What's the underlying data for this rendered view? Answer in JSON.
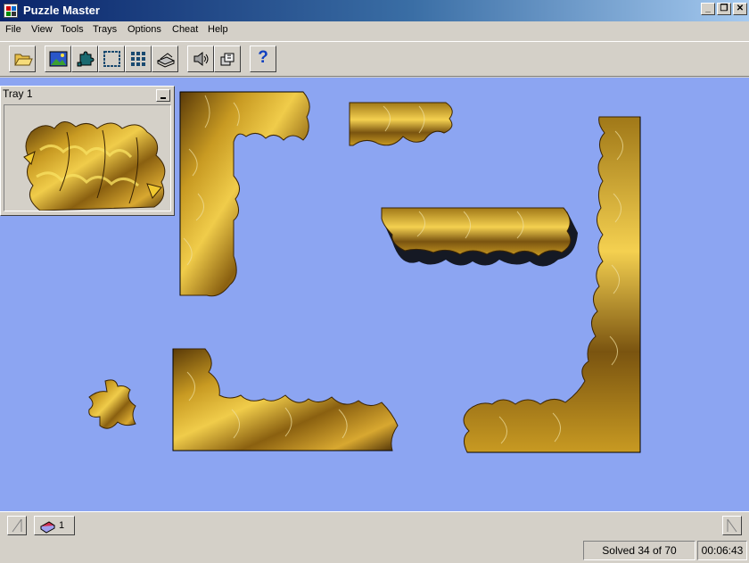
{
  "window": {
    "title": "Puzzle Master"
  },
  "menu": [
    "File",
    "View",
    "Tools",
    "Trays",
    "Options",
    "Cheat",
    "Help"
  ],
  "toolbar": {
    "buttons": [
      {
        "icon": "open-folder-icon"
      },
      {
        "icon": "picture-icon"
      },
      {
        "icon": "puzzle-pieces-icon"
      },
      {
        "icon": "border-frame-icon"
      },
      {
        "icon": "grid-icon"
      },
      {
        "icon": "tray-icon"
      },
      {
        "icon": "speaker-icon"
      },
      {
        "icon": "pieces-stack-icon"
      },
      {
        "icon": "help-icon"
      }
    ],
    "help_label": "?"
  },
  "tray": {
    "title": "Tray 1"
  },
  "bottombar": {
    "tray_count": "1"
  },
  "status": {
    "solved": "Solved 34 of 70",
    "timer": "00:06:43"
  },
  "colors": {
    "canvas": "#8ca5f2",
    "gold": "#c89a22",
    "dark_gold": "#5a3a08",
    "title_blue": "#0a246a"
  }
}
